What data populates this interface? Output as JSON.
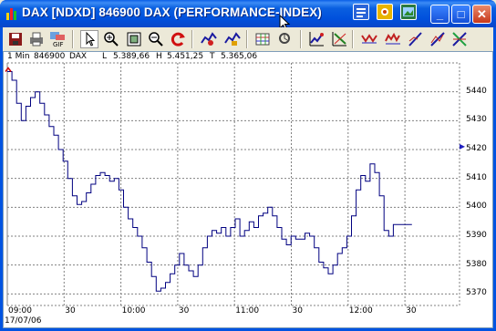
{
  "window": {
    "title": "DAX [NDXD]  846900  DAX (PERFORMANCE-INDEX)",
    "colors": {
      "titlebar": "#0054e3",
      "close": "#c7391b",
      "chart_line": "#000080"
    }
  },
  "titlebar_tools": [
    "window-list-icon",
    "settings-icon",
    "picture-icon"
  ],
  "window_controls": {
    "minimize": "_",
    "maximize": "□",
    "close": "✕"
  },
  "toolbar": {
    "items": [
      "save-icon",
      "print-icon",
      "export-gif-icon",
      "pointer-icon",
      "zoom-in-icon",
      "zoom-area-icon",
      "zoom-out-icon",
      "refresh-icon",
      "indicator-add-icon",
      "indicator-settings-icon",
      "grid-icon",
      "calculator-icon",
      "chart-type-icon",
      "chart-style-icon",
      "trend-line-icon",
      "wave-icon",
      "draw-line-icon",
      "fan-icon",
      "delete-drawings-icon"
    ],
    "export_label": "GIF"
  },
  "info": {
    "interval": "1 Min",
    "symbol_id": "846900",
    "symbol": "DAX",
    "low_label": "L",
    "low": "5.389,66",
    "high_label": "H",
    "high": "5.451,25",
    "last_label": "T",
    "last": "5.365,06"
  },
  "chart_data": {
    "type": "line",
    "title": "",
    "xlabel": "",
    "ylabel": "",
    "ylim": [
      5366,
      5450
    ],
    "y_ticks": [
      5440,
      5430,
      5420,
      5410,
      5400,
      5390,
      5380,
      5370
    ],
    "x_ticks": [
      "09:00",
      "30",
      "10:00",
      "30",
      "11:00",
      "30",
      "12:00",
      "30"
    ],
    "date": "17/07/06",
    "grid": true,
    "series": [
      {
        "x": [
          0,
          3,
          6,
          9,
          12,
          15,
          18,
          21,
          24,
          27,
          30,
          33,
          36,
          39,
          42,
          45,
          48,
          51,
          54,
          57,
          60,
          63,
          66,
          69,
          72,
          75,
          78,
          81,
          84,
          87,
          90,
          93,
          96,
          99,
          102,
          105,
          108,
          111,
          114,
          117,
          120,
          123,
          126,
          129,
          132,
          135,
          138,
          141,
          144,
          147,
          150,
          153,
          156,
          159,
          162,
          165,
          168,
          171,
          174,
          177,
          180,
          183,
          186,
          189,
          192,
          195,
          198,
          201,
          204,
          207,
          210,
          213,
          216,
          219,
          222,
          225,
          228,
          231,
          234,
          237,
          240,
          243,
          246,
          249,
          252,
          255,
          258,
          261,
          264,
          267,
          270,
          273,
          276,
          279,
          282,
          285,
          288,
          291,
          294,
          297,
          300,
          303,
          306,
          309
        ],
        "values": [
          5447,
          5444,
          5436,
          5430,
          5435,
          5438,
          5440,
          5436,
          5432,
          5428,
          5425,
          5420,
          5416,
          5410,
          5404,
          5401,
          5402,
          5405,
          5408,
          5411,
          5412,
          5411,
          5409,
          5410,
          5406,
          5400,
          5396,
          5393,
          5390,
          5386,
          5381,
          5376,
          5371,
          5372,
          5374,
          5377,
          5380,
          5384,
          5380,
          5378,
          5376,
          5380,
          5386,
          5390,
          5392,
          5391,
          5393,
          5390,
          5393,
          5396,
          5390,
          5392,
          5395,
          5393,
          5397,
          5398,
          5400,
          5397,
          5393,
          5389,
          5387,
          5390,
          5389,
          5389,
          5391,
          5390,
          5386,
          5381,
          5379,
          5377,
          5380,
          5384,
          5386,
          5390,
          5397,
          5406,
          5411,
          5409,
          5415,
          5412,
          5404,
          5392,
          5390,
          5394,
          5394,
          5394,
          5394,
          5394,
          5394,
          5394,
          5394,
          5394,
          5394,
          5394,
          5394,
          5394,
          5394,
          5394,
          5394,
          5394,
          5394,
          5394,
          5394,
          5394
        ]
      }
    ],
    "current_marker": 5421
  }
}
